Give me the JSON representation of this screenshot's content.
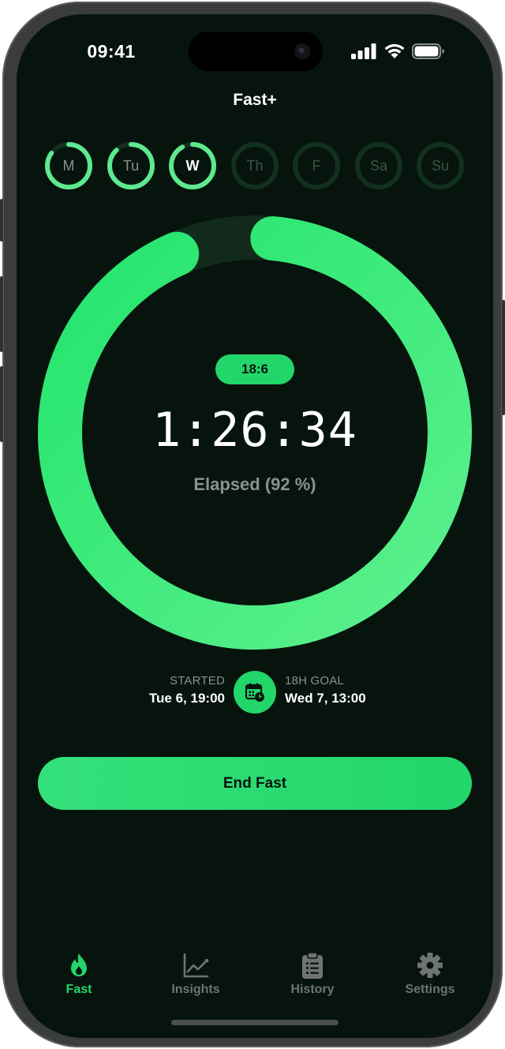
{
  "status_bar": {
    "time": "09:41"
  },
  "header": {
    "title": "Fast+"
  },
  "week": {
    "days": [
      {
        "label": "M",
        "progress": 0.85,
        "state": "done"
      },
      {
        "label": "Tu",
        "progress": 0.88,
        "state": "done"
      },
      {
        "label": "W",
        "progress": 0.92,
        "state": "current"
      },
      {
        "label": "Th",
        "progress": 0,
        "state": "future"
      },
      {
        "label": "F",
        "progress": 0,
        "state": "future"
      },
      {
        "label": "Sa",
        "progress": 0,
        "state": "future"
      },
      {
        "label": "Su",
        "progress": 0,
        "state": "future"
      }
    ]
  },
  "timer": {
    "plan": "18:6",
    "elapsed": "1:26:34",
    "elapsed_caption": "Elapsed (92 %)",
    "progress": 0.92
  },
  "schedule": {
    "started_label": "STARTED",
    "started_value": "Tue 6, 19:00",
    "goal_label": "18H GOAL",
    "goal_value": "Wed 7, 13:00"
  },
  "actions": {
    "end_fast_label": "End Fast"
  },
  "tabbar": {
    "items": [
      {
        "label": "Fast",
        "icon": "flame-icon",
        "active": true
      },
      {
        "label": "Insights",
        "icon": "chart-line-icon",
        "active": false
      },
      {
        "label": "History",
        "icon": "clipboard-icon",
        "active": false
      },
      {
        "label": "Settings",
        "icon": "gear-icon",
        "active": false
      }
    ]
  },
  "colors": {
    "accent": "#22d66a",
    "accent_light": "#5ee88f",
    "background": "#06140d",
    "track": "#12301f",
    "muted_text": "#8c918e"
  }
}
